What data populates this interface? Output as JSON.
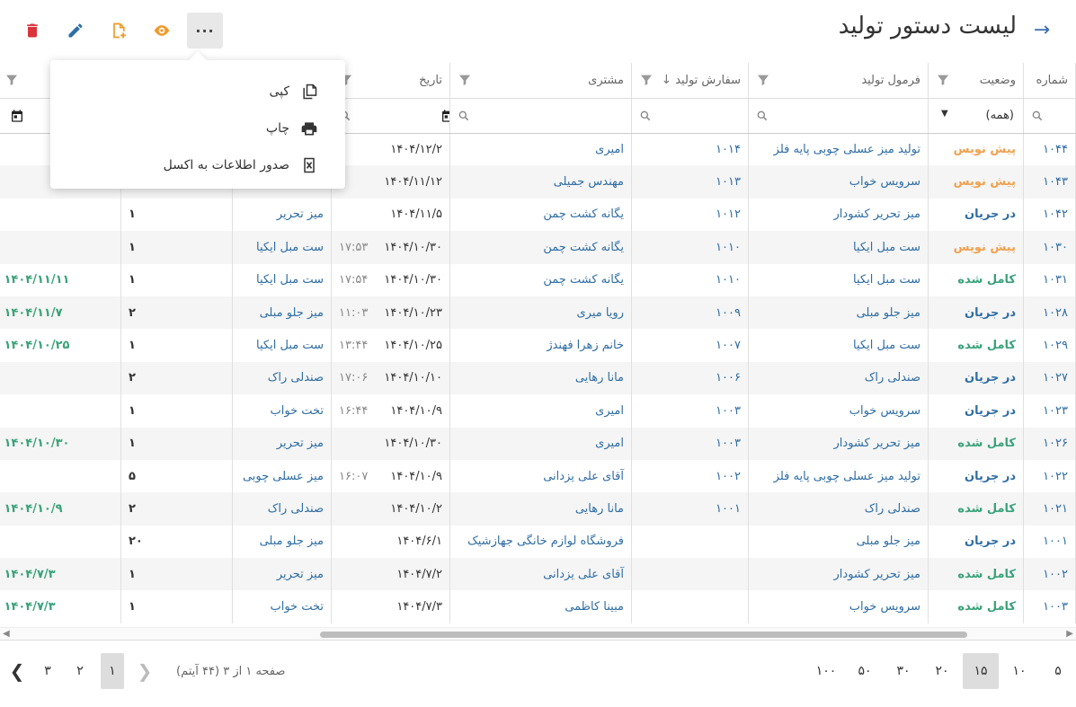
{
  "header": {
    "title": "لیست دستور تولید",
    "more_label": "···"
  },
  "menu": {
    "items": [
      {
        "label": "کپی",
        "icon": "copy-icon"
      },
      {
        "label": "چاپ",
        "icon": "print-icon"
      },
      {
        "label": "صدور اطلاعات به اکسل",
        "icon": "excel-icon"
      }
    ]
  },
  "colors": {
    "draft": "#f0a14e",
    "in_progress": "#2e6da4",
    "done": "#3aa27a",
    "delete": "#d9343c",
    "edit": "#2e6da4",
    "add": "#f09a2a",
    "view": "#f09a2a"
  },
  "columns": {
    "number": "شماره",
    "status": "وضعیت",
    "formula": "فرمول تولید",
    "order": "سفارش تولید",
    "customer": "مشتری",
    "date": "تاریخ"
  },
  "filters": {
    "status_value": "(همه)"
  },
  "rows": [
    {
      "num": "۱۰۴۴",
      "status": "پیش نویس",
      "st": "draft",
      "formula": "تولید میز عسلی چوبی پایه فلز",
      "order": "۱۰۱۴",
      "customer": "امیری",
      "date": "۱۴۰۴/۱۲/۲",
      "time": "",
      "product": "",
      "qty": "",
      "due": ""
    },
    {
      "num": "۱۰۴۳",
      "status": "پیش نویس",
      "st": "draft",
      "formula": "سرویس خواب",
      "order": "۱۰۱۳",
      "customer": "مهندس جمیلی",
      "date": "۱۴۰۴/۱۱/۱۲",
      "time": "",
      "product": "",
      "qty": "",
      "due": ""
    },
    {
      "num": "۱۰۴۲",
      "status": "در جریان",
      "st": "progress",
      "formula": "میز تحریر کشودار",
      "order": "۱۰۱۲",
      "customer": "یگانه کشت چمن",
      "date": "۱۴۰۴/۱۱/۵",
      "time": "",
      "product": "میز تحریر",
      "qty": "۱",
      "due": ""
    },
    {
      "num": "۱۰۳۰",
      "status": "پیش نویس",
      "st": "draft",
      "formula": "ست مبل ایکیا",
      "order": "۱۰۱۰",
      "customer": "یگانه کشت چمن",
      "date": "۱۴۰۴/۱۰/۳۰",
      "time": "۱۷:۵۳",
      "product": "ست مبل ایکیا",
      "qty": "۱",
      "due": ""
    },
    {
      "num": "۱۰۳۱",
      "status": "کامل شده",
      "st": "done",
      "formula": "ست مبل ایکیا",
      "order": "۱۰۱۰",
      "customer": "یگانه کشت چمن",
      "date": "۱۴۰۴/۱۰/۳۰",
      "time": "۱۷:۵۴",
      "product": "ست مبل ایکیا",
      "qty": "۱",
      "due": "۱۴۰۴/۱۱/۱۱"
    },
    {
      "num": "۱۰۲۸",
      "status": "در جریان",
      "st": "progress",
      "formula": "میز جلو مبلی",
      "order": "۱۰۰۹",
      "customer": "رویا میری",
      "date": "۱۴۰۴/۱۰/۲۳",
      "time": "۱۱:۰۳",
      "product": "میز جلو مبلی",
      "qty": "۲",
      "due": "۱۴۰۴/۱۱/۷"
    },
    {
      "num": "۱۰۲۹",
      "status": "کامل شده",
      "st": "done",
      "formula": "ست مبل ایکیا",
      "order": "۱۰۰۷",
      "customer": "خانم زهرا فهندژ",
      "date": "۱۴۰۴/۱۰/۲۵",
      "time": "۱۳:۴۴",
      "product": "ست مبل ایکیا",
      "qty": "۱",
      "due": "۱۴۰۴/۱۰/۲۵"
    },
    {
      "num": "۱۰۲۷",
      "status": "در جریان",
      "st": "progress",
      "formula": "صندلی راک",
      "order": "۱۰۰۶",
      "customer": "مانا رهایی",
      "date": "۱۴۰۴/۱۰/۱۰",
      "time": "۱۷:۰۶",
      "product": "صندلی راک",
      "qty": "۲",
      "due": ""
    },
    {
      "num": "۱۰۲۳",
      "status": "در جریان",
      "st": "progress",
      "formula": "سرویس خواب",
      "order": "۱۰۰۳",
      "customer": "امیری",
      "date": "۱۴۰۴/۱۰/۹",
      "time": "۱۶:۴۴",
      "product": "تخت خواب",
      "qty": "۱",
      "due": ""
    },
    {
      "num": "۱۰۲۶",
      "status": "کامل شده",
      "st": "done",
      "formula": "میز تحریر کشودار",
      "order": "۱۰۰۳",
      "customer": "امیری",
      "date": "۱۴۰۴/۱۰/۳۰",
      "time": "",
      "product": "میز تحریر",
      "qty": "۱",
      "due": "۱۴۰۴/۱۰/۳۰"
    },
    {
      "num": "۱۰۲۲",
      "status": "در جریان",
      "st": "progress",
      "formula": "تولید میز عسلی چوبی پایه فلز",
      "order": "۱۰۰۲",
      "customer": "آقای علی یزدانی",
      "date": "۱۴۰۴/۱۰/۹",
      "time": "۱۶:۰۷",
      "product": "میز عسلی چوبی",
      "qty": "۵",
      "due": ""
    },
    {
      "num": "۱۰۲۱",
      "status": "کامل شده",
      "st": "done",
      "formula": "صندلی راک",
      "order": "۱۰۰۱",
      "customer": "مانا رهایی",
      "date": "۱۴۰۴/۱۰/۲",
      "time": "",
      "product": "صندلی راک",
      "qty": "۲",
      "due": "۱۴۰۴/۱۰/۹"
    },
    {
      "num": "۱۰۰۱",
      "status": "در جریان",
      "st": "progress",
      "formula": "میز جلو مبلی",
      "order": "",
      "customer": "فروشگاه لوازم خانگی جهازشیک",
      "date": "۱۴۰۴/۶/۱",
      "time": "",
      "product": "میز جلو مبلی",
      "qty": "۲۰",
      "due": ""
    },
    {
      "num": "۱۰۰۲",
      "status": "کامل شده",
      "st": "done",
      "formula": "میز تحریر کشودار",
      "order": "",
      "customer": "آقای علی یزدانی",
      "date": "۱۴۰۴/۷/۲",
      "time": "",
      "product": "میز تحریر",
      "qty": "۱",
      "due": "۱۴۰۴/۷/۳"
    },
    {
      "num": "۱۰۰۳",
      "status": "کامل شده",
      "st": "done",
      "formula": "سرویس خواب",
      "order": "",
      "customer": "مبینا کاظمی",
      "date": "۱۴۰۴/۷/۳",
      "time": "",
      "product": "تخت خواب",
      "qty": "۱",
      "due": "۱۴۰۴/۷/۳"
    }
  ],
  "pager": {
    "sizes": [
      "۵",
      "۱۰",
      "۱۵",
      "۲۰",
      "۳۰",
      "۵۰",
      "۱۰۰"
    ],
    "selected_size": "۱۵",
    "info": "صفحه ۱ از ۳ (۴۴ آیتم)",
    "pages": [
      "۱",
      "۲",
      "۳"
    ],
    "current_page": "۱"
  }
}
